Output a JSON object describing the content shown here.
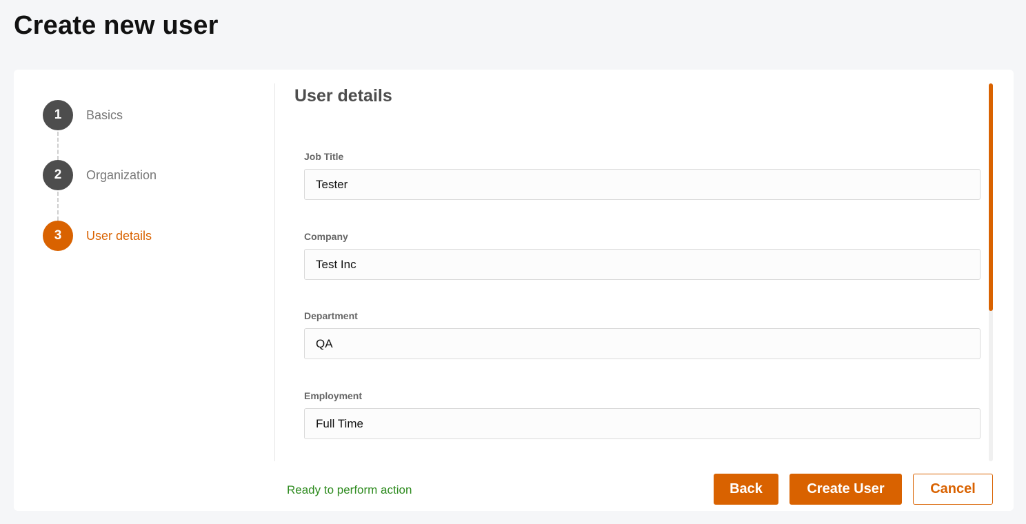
{
  "page": {
    "title": "Create new user"
  },
  "stepper": {
    "steps": [
      {
        "number": "1",
        "label": "Basics",
        "state": "complete"
      },
      {
        "number": "2",
        "label": "Organization",
        "state": "complete"
      },
      {
        "number": "3",
        "label": "User details",
        "state": "active"
      }
    ]
  },
  "form": {
    "section_title": "User details",
    "fields": [
      {
        "label": "Job Title",
        "value": "Tester"
      },
      {
        "label": "Company",
        "value": "Test Inc"
      },
      {
        "label": "Department",
        "value": "QA"
      },
      {
        "label": "Employment",
        "value": "Full Time"
      }
    ]
  },
  "footer": {
    "status": "Ready to perform action",
    "back_label": "Back",
    "create_label": "Create User",
    "cancel_label": "Cancel"
  },
  "colors": {
    "accent": "#d96200",
    "step_inactive": "#4d4d4d",
    "status_text": "#2e8b1f"
  }
}
